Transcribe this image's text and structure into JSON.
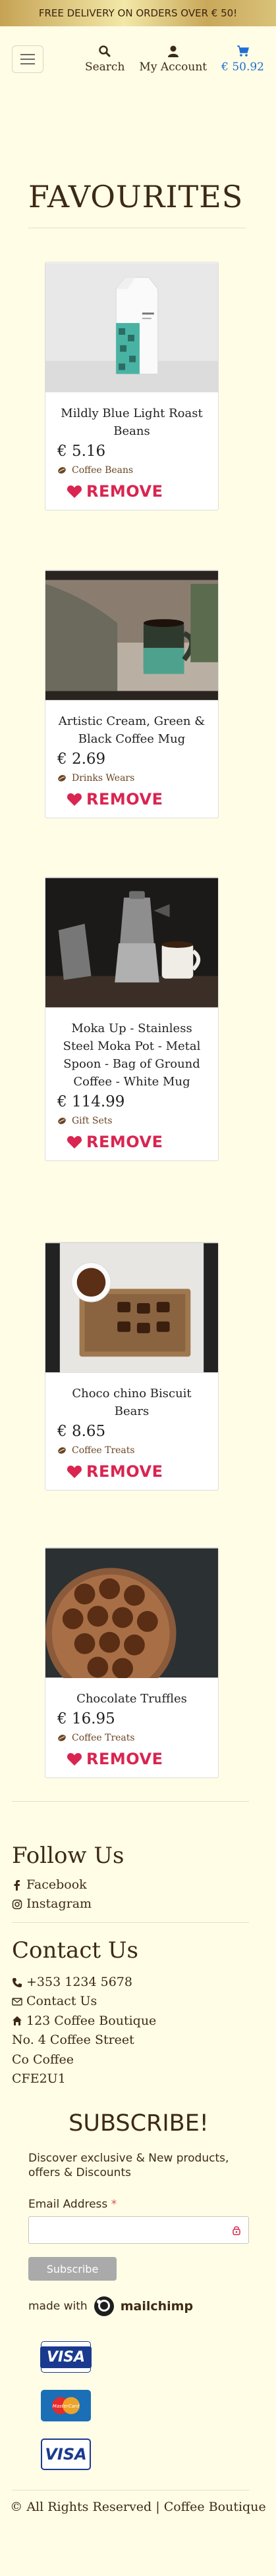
{
  "banner": {
    "text": "FREE DELIVERY ON ORDERS OVER € 50!"
  },
  "nav": {
    "search_label": "Search",
    "account_label": "My Account",
    "cart_label": "€ 50.92"
  },
  "page": {
    "title": "FAVOURITES"
  },
  "favourites": [
    {
      "name": "Mildly Blue Light Roast Beans",
      "price": "€ 5.16",
      "category": "Coffee Beans",
      "remove_label": "REMOVE"
    },
    {
      "name": "Artistic Cream, Green & Black Coffee Mug",
      "price": "€ 2.69",
      "category": "Drinks Wears",
      "remove_label": "REMOVE"
    },
    {
      "name": "Moka Up - Stainless Steel Moka Pot - Metal Spoon - Bag of Ground Coffee - White Mug",
      "price": "€ 114.99",
      "category": "Gift Sets",
      "remove_label": "REMOVE"
    },
    {
      "name": "Choco chino Biscuit Bears",
      "price": "€ 8.65",
      "category": "Coffee Treats",
      "remove_label": "REMOVE"
    },
    {
      "name": "Chocolate Truffles",
      "price": "€ 16.95",
      "category": "Coffee Treats",
      "remove_label": "REMOVE"
    }
  ],
  "footer": {
    "follow_title": "Follow Us",
    "facebook": "Facebook",
    "instagram": "Instagram",
    "contact_title": "Contact Us",
    "phone": "+353 1234 5678",
    "contact_link": "Contact Us",
    "address_name": "123 Coffee Boutique",
    "address_line1": "No. 4 Coffee Street",
    "address_line2": "Co Coffee",
    "address_line3": "CFE2U1",
    "subscribe_title": "SUBSCRIBE!",
    "subscribe_text": "Discover exclusive & New products, offers & Discounts",
    "email_label": "Email Address",
    "email_required": "*",
    "subscribe_button": "Subscribe",
    "made_with": "made with",
    "mailchimp": "mailchimp",
    "payment_cards": [
      "VISA",
      "MasterCard",
      "VISA"
    ],
    "copyright": "All Rights Reserved | Coffee Boutique"
  },
  "colors": {
    "accent_remove": "#d92550",
    "cart_blue": "#1f6fd1",
    "background": "#fffde6"
  }
}
